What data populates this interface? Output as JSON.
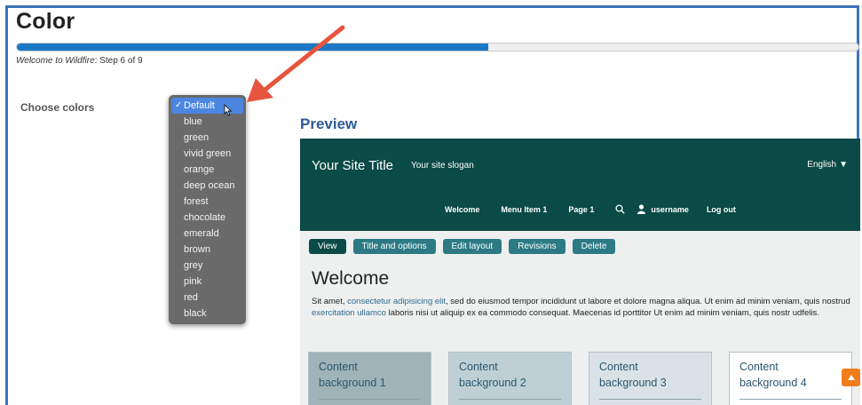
{
  "page": {
    "title": "Color",
    "step_prefix": "Welcome to Wildfire",
    "step_suffix": ": Step 6 of 9",
    "progress_fraction": 0.56
  },
  "form": {
    "choose_label": "Choose colors",
    "options": [
      "Default",
      "blue",
      "green",
      "vivid green",
      "orange",
      "deep ocean",
      "forest",
      "chocolate",
      "emerald",
      "brown",
      "grey",
      "pink",
      "red",
      "black"
    ],
    "selected": "Default",
    "check_mark": "✓"
  },
  "preview": {
    "heading": "Preview",
    "site_title": "Your Site Title",
    "site_slogan": "Your site slogan",
    "language": "English",
    "nav": {
      "welcome": "Welcome",
      "menu_item": "Menu Item 1",
      "page": "Page 1",
      "username": "username",
      "logout": "Log out"
    },
    "tabs": [
      "View",
      "Title and options",
      "Edit layout",
      "Revisions",
      "Delete"
    ],
    "welcome_title": "Welcome",
    "body": {
      "t1": "Sit amet, ",
      "link1": "consectetur adipisicing elit",
      "t2": ", sed do eiusmod tempor incididunt ut labore et dolore magna aliqua. Ut enim ad minim veniam, quis nostrud ",
      "link2": "exercitation ullamco",
      "t3": " laboris nisi ut aliquip ex ea commodo consequat. Maecenas id porttitor Ut enim ad minim veniam, quis nostr udfelis."
    },
    "cards": [
      {
        "line1": "Content",
        "line2": "background 1"
      },
      {
        "line1": "Content",
        "line2": "background 2"
      },
      {
        "line1": "Content",
        "line2": "background 3"
      },
      {
        "line1": "Content",
        "line2": "background 4"
      }
    ]
  },
  "colors": {
    "accent": "#1b78c4",
    "header_bg": "#0a4a47",
    "tab_bg": "#2c7b84",
    "annotation_arrow": "#e8553e",
    "back_to_top": "#f07c1a"
  },
  "icons": {
    "cursor": "pointer-cursor-icon",
    "arrow": "annotation-arrow-icon",
    "search": "search-icon",
    "user": "user-icon",
    "back_to_top": "back-to-top-icon"
  }
}
